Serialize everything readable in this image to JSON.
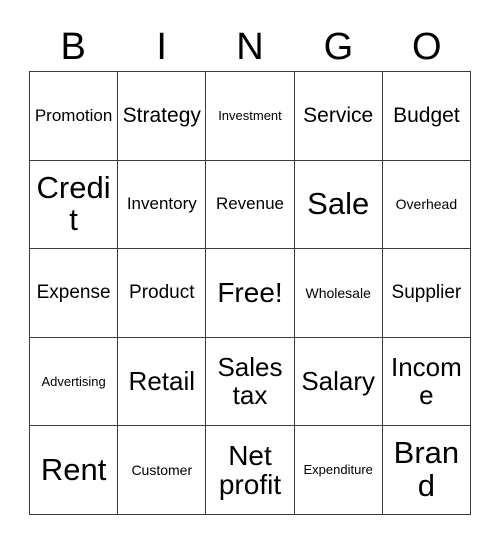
{
  "card": {
    "title": "BINGO",
    "header_letters": [
      "B",
      "I",
      "N",
      "G",
      "O"
    ],
    "colors": {
      "background": "#ffffff",
      "text": "#000000",
      "grid_line": "#3a3a3a"
    },
    "grid_size": "5x5",
    "free_space": "Free!",
    "rows": [
      [
        {
          "label": "Promotion",
          "size": "fs-m"
        },
        {
          "label": "Strategy",
          "size": "fs-xl"
        },
        {
          "label": "Investment",
          "size": "fs-xs"
        },
        {
          "label": "Service",
          "size": "fs-xl"
        },
        {
          "label": "Budget",
          "size": "fs-xl"
        }
      ],
      [
        {
          "label": "Credit",
          "size": "fs-max"
        },
        {
          "label": "Inventory",
          "size": "fs-m"
        },
        {
          "label": "Revenue",
          "size": "fs-m"
        },
        {
          "label": "Sale",
          "size": "fs-max"
        },
        {
          "label": "Overhead",
          "size": "fs-s"
        }
      ],
      [
        {
          "label": "Expense",
          "size": "fs-l"
        },
        {
          "label": "Product",
          "size": "fs-l"
        },
        {
          "label": "Free!",
          "size": "fs-huge"
        },
        {
          "label": "Wholesale",
          "size": "fs-s"
        },
        {
          "label": "Supplier",
          "size": "fs-l"
        }
      ],
      [
        {
          "label": "Advertising",
          "size": "fs-xs"
        },
        {
          "label": "Retail",
          "size": "fs-xxl"
        },
        {
          "label": "Sales tax",
          "size": "fs-xxl"
        },
        {
          "label": "Salary",
          "size": "fs-xxl"
        },
        {
          "label": "Income",
          "size": "fs-xxl"
        }
      ],
      [
        {
          "label": "Rent",
          "size": "fs-max"
        },
        {
          "label": "Customer",
          "size": "fs-s"
        },
        {
          "label": "Net profit",
          "size": "fs-huge"
        },
        {
          "label": "Expenditure",
          "size": "fs-xs"
        },
        {
          "label": "Brand",
          "size": "fs-max"
        }
      ]
    ]
  }
}
